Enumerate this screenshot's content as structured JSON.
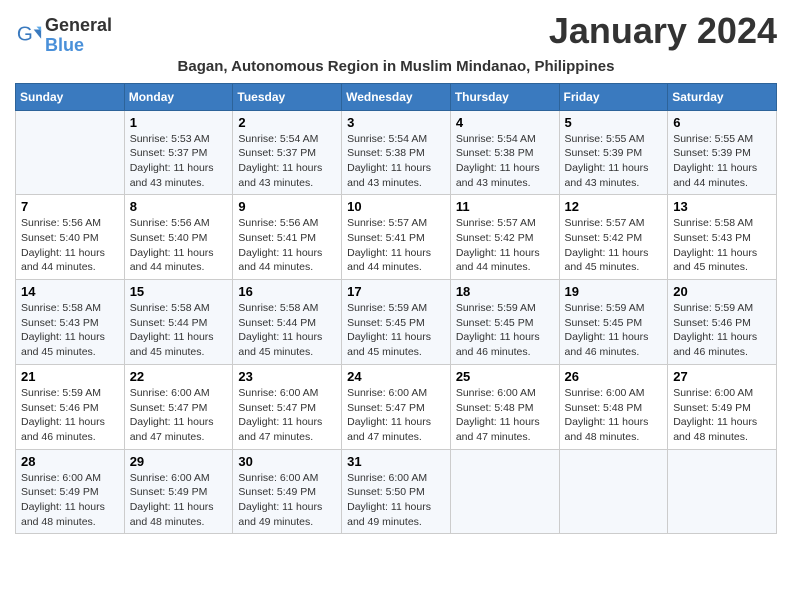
{
  "logo": {
    "general": "General",
    "blue": "Blue"
  },
  "title": "January 2024",
  "subtitle": "Bagan, Autonomous Region in Muslim Mindanao, Philippines",
  "days_of_week": [
    "Sunday",
    "Monday",
    "Tuesday",
    "Wednesday",
    "Thursday",
    "Friday",
    "Saturday"
  ],
  "weeks": [
    [
      {
        "day": "",
        "info": ""
      },
      {
        "day": "1",
        "info": "Sunrise: 5:53 AM\nSunset: 5:37 PM\nDaylight: 11 hours\nand 43 minutes."
      },
      {
        "day": "2",
        "info": "Sunrise: 5:54 AM\nSunset: 5:37 PM\nDaylight: 11 hours\nand 43 minutes."
      },
      {
        "day": "3",
        "info": "Sunrise: 5:54 AM\nSunset: 5:38 PM\nDaylight: 11 hours\nand 43 minutes."
      },
      {
        "day": "4",
        "info": "Sunrise: 5:54 AM\nSunset: 5:38 PM\nDaylight: 11 hours\nand 43 minutes."
      },
      {
        "day": "5",
        "info": "Sunrise: 5:55 AM\nSunset: 5:39 PM\nDaylight: 11 hours\nand 43 minutes."
      },
      {
        "day": "6",
        "info": "Sunrise: 5:55 AM\nSunset: 5:39 PM\nDaylight: 11 hours\nand 44 minutes."
      }
    ],
    [
      {
        "day": "7",
        "info": "Sunrise: 5:56 AM\nSunset: 5:40 PM\nDaylight: 11 hours\nand 44 minutes."
      },
      {
        "day": "8",
        "info": "Sunrise: 5:56 AM\nSunset: 5:40 PM\nDaylight: 11 hours\nand 44 minutes."
      },
      {
        "day": "9",
        "info": "Sunrise: 5:56 AM\nSunset: 5:41 PM\nDaylight: 11 hours\nand 44 minutes."
      },
      {
        "day": "10",
        "info": "Sunrise: 5:57 AM\nSunset: 5:41 PM\nDaylight: 11 hours\nand 44 minutes."
      },
      {
        "day": "11",
        "info": "Sunrise: 5:57 AM\nSunset: 5:42 PM\nDaylight: 11 hours\nand 44 minutes."
      },
      {
        "day": "12",
        "info": "Sunrise: 5:57 AM\nSunset: 5:42 PM\nDaylight: 11 hours\nand 45 minutes."
      },
      {
        "day": "13",
        "info": "Sunrise: 5:58 AM\nSunset: 5:43 PM\nDaylight: 11 hours\nand 45 minutes."
      }
    ],
    [
      {
        "day": "14",
        "info": "Sunrise: 5:58 AM\nSunset: 5:43 PM\nDaylight: 11 hours\nand 45 minutes."
      },
      {
        "day": "15",
        "info": "Sunrise: 5:58 AM\nSunset: 5:44 PM\nDaylight: 11 hours\nand 45 minutes."
      },
      {
        "day": "16",
        "info": "Sunrise: 5:58 AM\nSunset: 5:44 PM\nDaylight: 11 hours\nand 45 minutes."
      },
      {
        "day": "17",
        "info": "Sunrise: 5:59 AM\nSunset: 5:45 PM\nDaylight: 11 hours\nand 45 minutes."
      },
      {
        "day": "18",
        "info": "Sunrise: 5:59 AM\nSunset: 5:45 PM\nDaylight: 11 hours\nand 46 minutes."
      },
      {
        "day": "19",
        "info": "Sunrise: 5:59 AM\nSunset: 5:45 PM\nDaylight: 11 hours\nand 46 minutes."
      },
      {
        "day": "20",
        "info": "Sunrise: 5:59 AM\nSunset: 5:46 PM\nDaylight: 11 hours\nand 46 minutes."
      }
    ],
    [
      {
        "day": "21",
        "info": "Sunrise: 5:59 AM\nSunset: 5:46 PM\nDaylight: 11 hours\nand 46 minutes."
      },
      {
        "day": "22",
        "info": "Sunrise: 6:00 AM\nSunset: 5:47 PM\nDaylight: 11 hours\nand 47 minutes."
      },
      {
        "day": "23",
        "info": "Sunrise: 6:00 AM\nSunset: 5:47 PM\nDaylight: 11 hours\nand 47 minutes."
      },
      {
        "day": "24",
        "info": "Sunrise: 6:00 AM\nSunset: 5:47 PM\nDaylight: 11 hours\nand 47 minutes."
      },
      {
        "day": "25",
        "info": "Sunrise: 6:00 AM\nSunset: 5:48 PM\nDaylight: 11 hours\nand 47 minutes."
      },
      {
        "day": "26",
        "info": "Sunrise: 6:00 AM\nSunset: 5:48 PM\nDaylight: 11 hours\nand 48 minutes."
      },
      {
        "day": "27",
        "info": "Sunrise: 6:00 AM\nSunset: 5:49 PM\nDaylight: 11 hours\nand 48 minutes."
      }
    ],
    [
      {
        "day": "28",
        "info": "Sunrise: 6:00 AM\nSunset: 5:49 PM\nDaylight: 11 hours\nand 48 minutes."
      },
      {
        "day": "29",
        "info": "Sunrise: 6:00 AM\nSunset: 5:49 PM\nDaylight: 11 hours\nand 48 minutes."
      },
      {
        "day": "30",
        "info": "Sunrise: 6:00 AM\nSunset: 5:49 PM\nDaylight: 11 hours\nand 49 minutes."
      },
      {
        "day": "31",
        "info": "Sunrise: 6:00 AM\nSunset: 5:50 PM\nDaylight: 11 hours\nand 49 minutes."
      },
      {
        "day": "",
        "info": ""
      },
      {
        "day": "",
        "info": ""
      },
      {
        "day": "",
        "info": ""
      }
    ]
  ]
}
